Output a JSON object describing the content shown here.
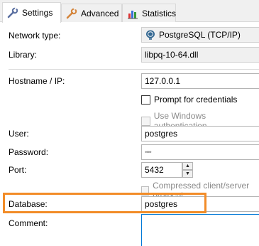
{
  "tabs": [
    {
      "label": "Settings",
      "icon": "wrench-icon",
      "active": true
    },
    {
      "label": "Advanced",
      "icon": "wrench-icon",
      "active": false
    },
    {
      "label": "Statistics",
      "icon": "bar-chart-icon",
      "active": false
    }
  ],
  "form": {
    "network_type": {
      "label": "Network type:",
      "value": "PostgreSQL (TCP/IP)",
      "icon": "postgresql-elephant-icon"
    },
    "library": {
      "label": "Library:",
      "value": "libpq-10-64.dll"
    },
    "hostname": {
      "label": "Hostname / IP:",
      "value": "127.0.0.1"
    },
    "prompt_credentials": {
      "label": "Prompt for credentials",
      "checked": false
    },
    "windows_auth": {
      "label": "Use Windows authentication",
      "checked": false,
      "disabled": true
    },
    "user": {
      "label": "User:",
      "value": "postgres"
    },
    "password": {
      "label": "Password:",
      "value": "••••"
    },
    "port": {
      "label": "Port:",
      "value": "5432"
    },
    "compressed": {
      "label": "Compressed client/server protocol",
      "checked": false,
      "disabled": true
    },
    "database": {
      "label": "Database:",
      "value": "postgres"
    },
    "comment": {
      "label": "Comment:",
      "value": ""
    }
  },
  "colors": {
    "highlight": "#f28c28",
    "focus_border": "#0078d7"
  }
}
